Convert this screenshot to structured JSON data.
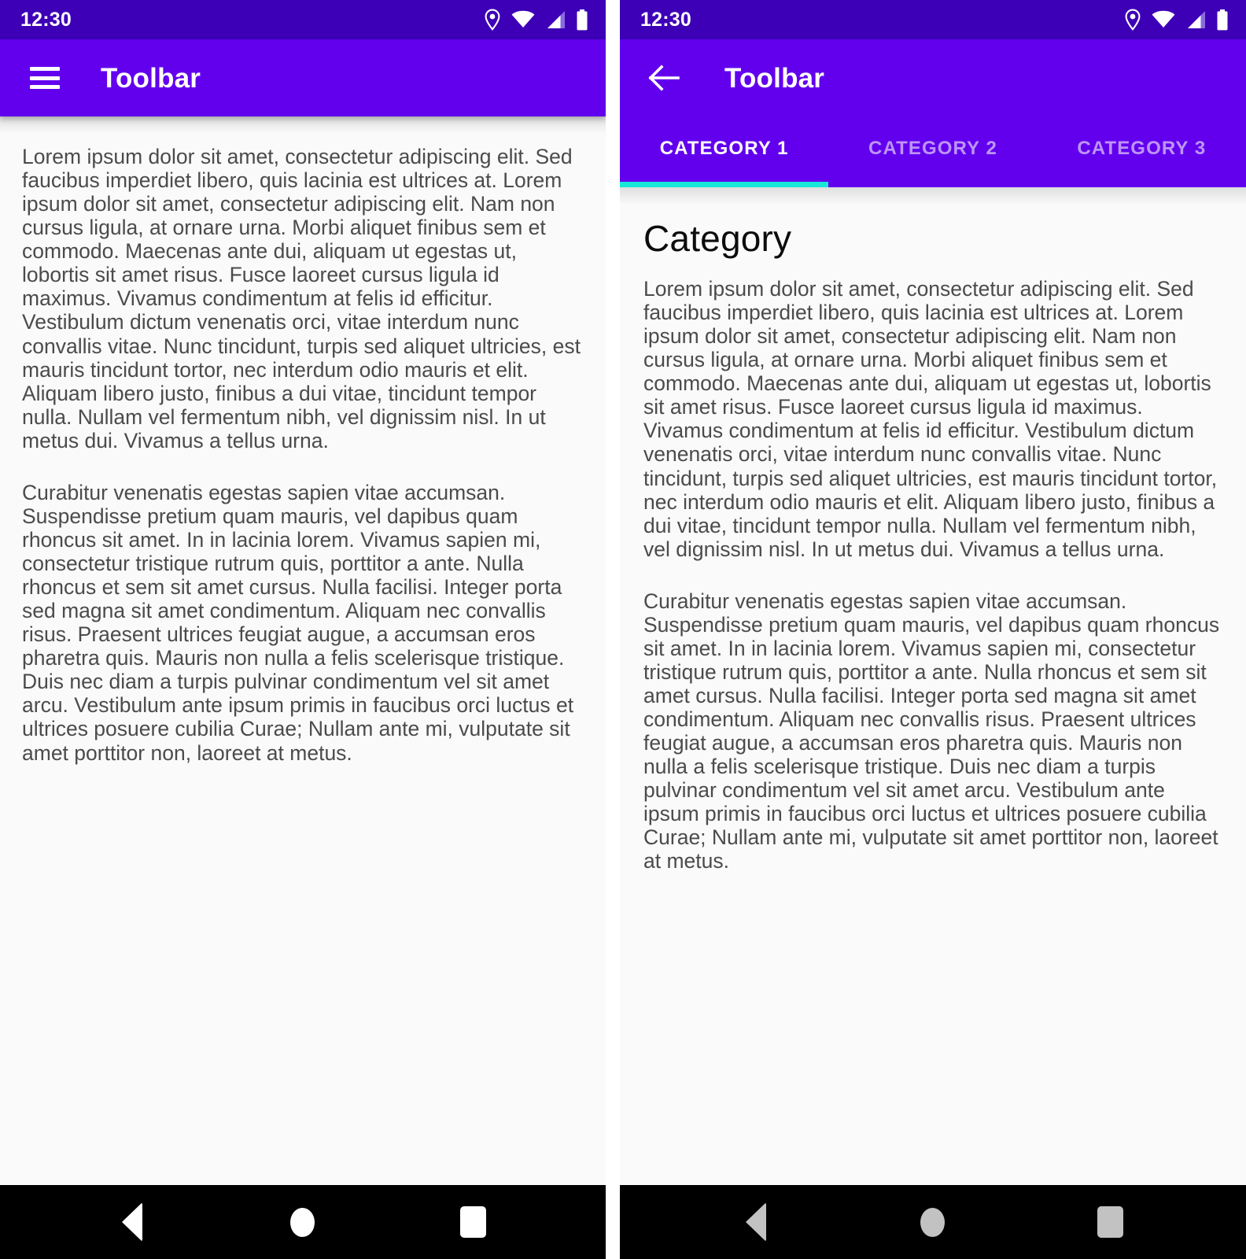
{
  "colors": {
    "status_bar": "#3d00b7",
    "toolbar": "#6200ee",
    "tab_indicator": "#18e8d8",
    "content_bg": "#fafafa",
    "body_text": "#4b4b4b",
    "nav_bar": "#000000"
  },
  "status_bar": {
    "time": "12:30",
    "icons": [
      "location-pin-icon",
      "wifi-icon",
      "cellular-signal-icon",
      "battery-icon"
    ]
  },
  "left_screen": {
    "toolbar": {
      "menu_icon": "hamburger-menu-icon",
      "title": "Toolbar"
    },
    "content": {
      "paragraphs": [
        "Lorem ipsum dolor sit amet, consectetur adipiscing elit. Sed faucibus imperdiet libero, quis lacinia est ultrices at. Lorem ipsum dolor sit amet, consectetur adipiscing elit. Nam non cursus ligula, at ornare urna. Morbi aliquet finibus sem et commodo. Maecenas ante dui, aliquam ut egestas ut, lobortis sit amet risus. Fusce laoreet cursus ligula id maximus. Vivamus condimentum at felis id efficitur. Vestibulum dictum venenatis orci, vitae interdum nunc convallis vitae. Nunc tincidunt, turpis sed aliquet ultricies, est mauris tincidunt tortor, nec interdum odio mauris et elit. Aliquam libero justo, finibus a dui vitae, tincidunt tempor nulla. Nullam vel fermentum nibh, vel dignissim nisl. In ut metus dui. Vivamus a tellus urna.",
        "Curabitur venenatis egestas sapien vitae accumsan. Suspendisse pretium quam mauris, vel dapibus quam rhoncus sit amet. In in lacinia lorem. Vivamus sapien mi, consectetur tristique rutrum quis, porttitor a ante. Nulla rhoncus et sem sit amet cursus. Nulla facilisi. Integer porta sed magna sit amet condimentum. Aliquam nec convallis risus. Praesent ultrices feugiat augue, a accumsan eros pharetra quis. Mauris non nulla a felis scelerisque tristique. Duis nec diam a turpis pulvinar condimentum vel sit amet arcu. Vestibulum ante ipsum primis in faucibus orci luctus et ultrices posuere cubilia Curae; Nullam ante mi, vulputate sit amet porttitor non, laoreet at metus."
      ]
    },
    "nav_bar": {
      "back_label": "back-button",
      "home_label": "home-button",
      "recents_label": "recents-button"
    }
  },
  "right_screen": {
    "toolbar": {
      "back_icon": "arrow-left-icon",
      "title": "Toolbar"
    },
    "tabs": [
      {
        "label": "CATEGORY 1",
        "active": true
      },
      {
        "label": "CATEGORY 2",
        "active": false
      },
      {
        "label": "CATEGORY 3",
        "active": false
      }
    ],
    "content": {
      "heading": "Category",
      "paragraphs": [
        "Lorem ipsum dolor sit amet, consectetur adipiscing elit. Sed faucibus imperdiet libero, quis lacinia est ultrices at. Lorem ipsum dolor sit amet, consectetur adipiscing elit. Nam non cursus ligula, at ornare urna. Morbi aliquet finibus sem et commodo. Maecenas ante dui, aliquam ut egestas ut, lobortis sit amet risus. Fusce laoreet cursus ligula id maximus. Vivamus condimentum at felis id efficitur. Vestibulum dictum venenatis orci, vitae interdum nunc convallis vitae. Nunc tincidunt, turpis sed aliquet ultricies, est mauris tincidunt tortor, nec interdum odio mauris et elit. Aliquam libero justo, finibus a dui vitae, tincidunt tempor nulla. Nullam vel fermentum nibh, vel dignissim nisl. In ut metus dui. Vivamus a tellus urna.",
        "Curabitur venenatis egestas sapien vitae accumsan. Suspendisse pretium quam mauris, vel dapibus quam rhoncus sit amet. In in lacinia lorem. Vivamus sapien mi, consectetur tristique rutrum quis, porttitor a ante. Nulla rhoncus et sem sit amet cursus. Nulla facilisi. Integer porta sed magna sit amet condimentum. Aliquam nec convallis risus. Praesent ultrices feugiat augue, a accumsan eros pharetra quis. Mauris non nulla a felis scelerisque tristique. Duis nec diam a turpis pulvinar condimentum vel sit amet arcu. Vestibulum ante ipsum primis in faucibus orci luctus et ultrices posuere cubilia Curae; Nullam ante mi, vulputate sit amet porttitor non, laoreet at metus."
      ]
    },
    "nav_bar": {
      "back_label": "back-button",
      "home_label": "home-button",
      "recents_label": "recents-button"
    }
  }
}
